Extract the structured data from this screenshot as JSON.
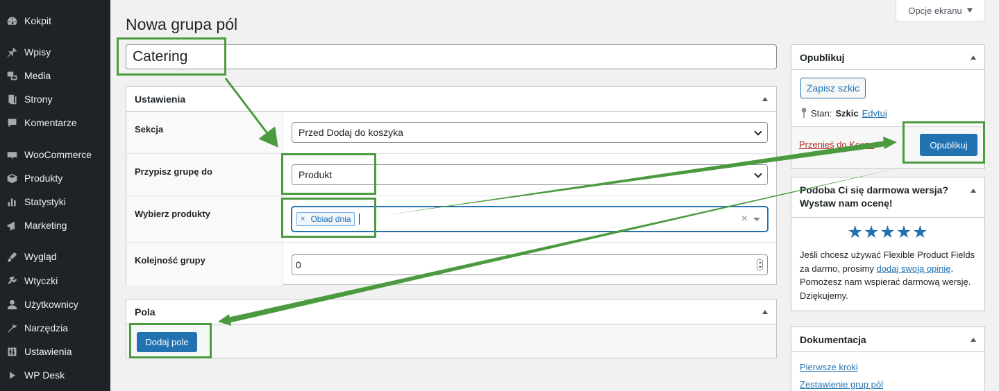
{
  "sidebar": {
    "items": [
      {
        "label": "Kokpit",
        "icon": "dashboard-icon"
      },
      {
        "label": "Wpisy",
        "icon": "pin-icon"
      },
      {
        "label": "Media",
        "icon": "media-icon"
      },
      {
        "label": "Strony",
        "icon": "pages-icon"
      },
      {
        "label": "Komentarze",
        "icon": "comments-icon"
      },
      {
        "label": "WooCommerce",
        "icon": "woo-icon"
      },
      {
        "label": "Produkty",
        "icon": "products-icon"
      },
      {
        "label": "Statystyki",
        "icon": "stats-icon"
      },
      {
        "label": "Marketing",
        "icon": "marketing-icon"
      },
      {
        "label": "Wygląd",
        "icon": "appearance-icon"
      },
      {
        "label": "Wtyczki",
        "icon": "plugins-icon"
      },
      {
        "label": "Użytkownicy",
        "icon": "users-icon"
      },
      {
        "label": "Narzędzia",
        "icon": "tools-icon"
      },
      {
        "label": "Ustawienia",
        "icon": "settings-icon"
      },
      {
        "label": "WP Desk",
        "icon": "play-icon"
      }
    ]
  },
  "header": {
    "screen_options": "Opcje ekranu",
    "page_title": "Nowa grupa pól",
    "group_title": "Catering"
  },
  "settings": {
    "title": "Ustawienia",
    "rows": [
      {
        "label": "Sekcja",
        "value": "Przed Dodaj do koszyka"
      },
      {
        "label": "Przypisz grupę do",
        "value": "Produkt"
      },
      {
        "label": "Wybierz produkty",
        "tag": "Obiad dnia",
        "tag_remove": "×",
        "clear": "×"
      },
      {
        "label": "Kolejność grupy",
        "value": "0"
      }
    ]
  },
  "fields": {
    "title": "Pola",
    "add_button": "Dodaj pole"
  },
  "publish": {
    "title": "Opublikuj",
    "save_draft": "Zapisz szkic",
    "status_label": "Stan:",
    "status_value": "Szkic",
    "edit_link": "Edytuj",
    "trash_link": "Przenieś do Kosza",
    "publish_button": "Opublikuj"
  },
  "rate": {
    "title": "Podoba Ci się darmowa wersja? Wystaw nam ocenę!",
    "stars": "★★★★★",
    "text_before": "Jeśli chcesz używać Flexible Product Fields za darmo, prosimy ",
    "link": "dodaj swoją opinię",
    "text_after": ". Pomożesz nam wspierać darmową wersję. Dziękujemy."
  },
  "docs": {
    "title": "Dokumentacja",
    "links": [
      "Pierwsze kroki",
      "Zestawienie grup pól"
    ]
  },
  "colors": {
    "sidebar_bg": "#1d2327",
    "primary": "#2271b1",
    "annotation_green": "#4c9a3f",
    "star": "#2271b1",
    "trash": "#b32d2e"
  }
}
